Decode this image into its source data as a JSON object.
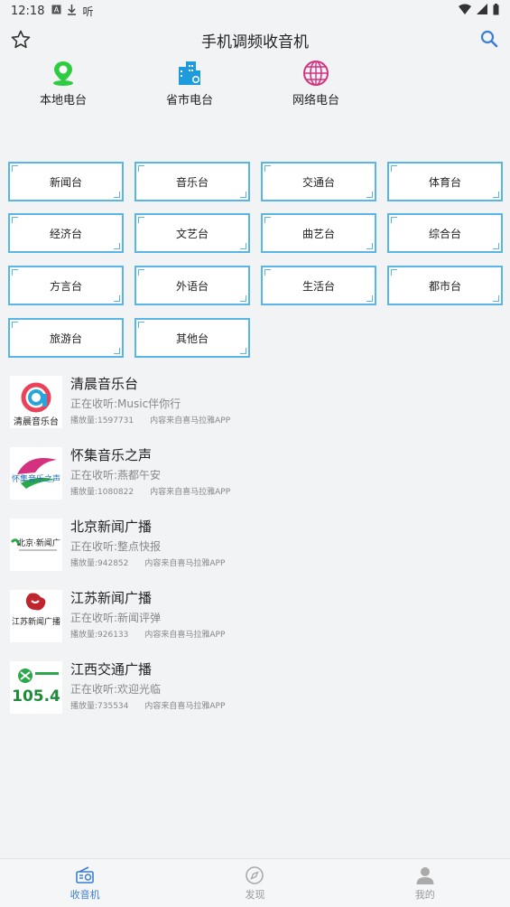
{
  "status": {
    "time": "12:18",
    "icons": [
      "notification-a-icon",
      "download-icon",
      "listen-icon"
    ],
    "listen_text": "听",
    "right_icons": [
      "wifi-icon",
      "signal-icon",
      "battery-icon"
    ]
  },
  "app_bar": {
    "title": "手机调频收音机",
    "left_icon": "star-outline-icon",
    "right_icon": "search-icon",
    "accent": "#3b7fd4"
  },
  "categories": [
    {
      "label": "本地电台",
      "icon": "location-pin-icon",
      "color": "#2ecc40"
    },
    {
      "label": "省市电台",
      "icon": "city-building-icon",
      "color": "#1e9bdc"
    },
    {
      "label": "网络电台",
      "icon": "globe-icon",
      "color": "#d6317e"
    }
  ],
  "genres": [
    "新闻台",
    "音乐台",
    "交通台",
    "体育台",
    "经济台",
    "文艺台",
    "曲艺台",
    "综合台",
    "方言台",
    "外语台",
    "生活台",
    "都市台",
    "旅游台",
    "其他台"
  ],
  "stations": [
    {
      "name": "清晨音乐台",
      "now": "正在收听:Music伴你行",
      "plays": "播放量:1597731",
      "source": "内容来自喜马拉雅APP",
      "logo_text": "清晨音乐台"
    },
    {
      "name": "怀集音乐之声",
      "now": "正在收听:燕都午安",
      "plays": "播放量:1080822",
      "source": "内容来自喜马拉雅APP",
      "logo_text": "怀集音乐之声"
    },
    {
      "name": "北京新闻广播",
      "now": "正在收听:整点快报",
      "plays": "播放量:942852",
      "source": "内容来自喜马拉雅APP",
      "logo_text": "北京·新闻广"
    },
    {
      "name": "江苏新闻广播",
      "now": "正在收听:新闻评弹",
      "plays": "播放量:926133",
      "source": "内容来自喜马拉雅APP",
      "logo_text": "江苏新闻广播"
    },
    {
      "name": "江西交通广播",
      "now": "正在收听:欢迎光临",
      "plays": "播放量:735534",
      "source": "内容来自喜马拉雅APP",
      "logo_text": "105.4"
    }
  ],
  "bottom_nav": [
    {
      "label": "收音机",
      "icon": "radio-icon",
      "active": true
    },
    {
      "label": "发现",
      "icon": "compass-icon",
      "active": false
    },
    {
      "label": "我的",
      "icon": "person-icon",
      "active": false
    }
  ],
  "colors": {
    "background": "#f2f3f5",
    "grid_border": "#59b5e6",
    "muted_text": "#888888"
  }
}
